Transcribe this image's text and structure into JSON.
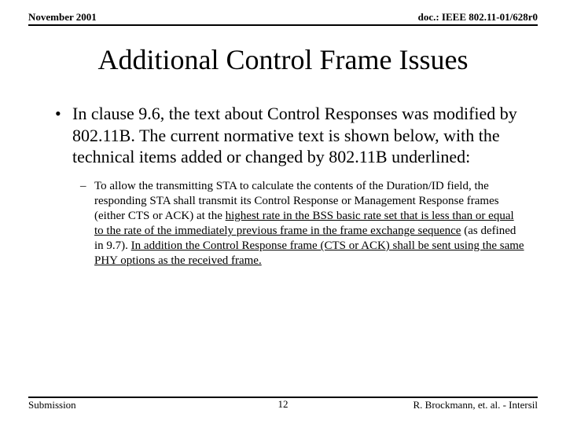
{
  "header": {
    "left": "November 2001",
    "right": "doc.: IEEE 802.11-01/628r0"
  },
  "title": "Additional Control Frame Issues",
  "bullet1": {
    "marker": "•",
    "text": "In clause 9.6, the text about Control Responses was modified by 802.11B.  The current normative text is shown below, with the technical items added or changed by 802.11B underlined:"
  },
  "bullet2": {
    "marker": "–",
    "pre": "To allow the transmitting STA to calculate the contents of the Duration/ID field, the responding STA shall transmit its Control Response or Management Response frames (either CTS or ACK) at the ",
    "u1": "highest rate in the BSS basic rate set that is less than or equal to the rate of the immediately previous frame in the frame exchange sequence",
    "mid": " (as defined in 9.7). ",
    "u2": "In addition the Control Response frame (CTS or ACK) shall be sent using the same PHY options as the received frame."
  },
  "footer": {
    "left": "Submission",
    "center": "12",
    "right": "R. Brockmann, et. al. - Intersil"
  }
}
